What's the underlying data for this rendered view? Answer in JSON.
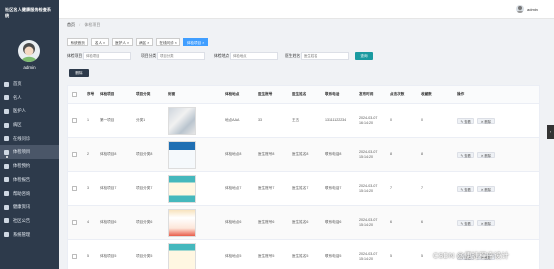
{
  "sidebar": {
    "title": "社区名人健康服务检查系统",
    "user": "admin",
    "items": [
      {
        "label": "首页",
        "icon": "home-icon"
      },
      {
        "label": "名人",
        "icon": "user-icon"
      },
      {
        "label": "医护人",
        "icon": "nurse-icon"
      },
      {
        "label": "病区",
        "icon": "ward-icon"
      },
      {
        "label": "在线问诊",
        "icon": "chat-icon"
      },
      {
        "label": "体检项目",
        "icon": "checkup-icon"
      },
      {
        "label": "体检预约",
        "icon": "calendar-icon"
      },
      {
        "label": "体检报告",
        "icon": "report-icon"
      },
      {
        "label": "帮助咨询",
        "icon": "help-icon"
      },
      {
        "label": "健康资讯",
        "icon": "news-icon"
      },
      {
        "label": "社区公告",
        "icon": "notice-icon"
      },
      {
        "label": "系统管理",
        "icon": "gear-icon"
      }
    ]
  },
  "header": {
    "user": "admin"
  },
  "breadcrumb": {
    "home": "首页",
    "sep": "/",
    "current": "体检项目"
  },
  "tabs": [
    {
      "label": "系统首页"
    },
    {
      "label": "名人 ×"
    },
    {
      "label": "医护人 ×"
    },
    {
      "label": "病区 ×"
    },
    {
      "label": "在线问诊 ×"
    },
    {
      "label": "体检项目 ×"
    }
  ],
  "search": {
    "fields": [
      {
        "label": "体检项目",
        "placeholder": "体检项目"
      },
      {
        "label": "项目分类",
        "placeholder": "项目分类"
      },
      {
        "label": "体检地点",
        "placeholder": "体检地点"
      },
      {
        "label": "医生姓名",
        "placeholder": "医生姓名"
      }
    ],
    "button": "查询"
  },
  "toolbar": {
    "delete_label": "删除"
  },
  "table": {
    "headers": [
      "序号",
      "体检项目",
      "项目分类",
      "封面",
      "体检地点",
      "医生账号",
      "医生姓名",
      "联系电话",
      "发布时间",
      "点击次数",
      "收藏数",
      "操作"
    ],
    "rows": [
      {
        "no": "1",
        "item": "第一项目",
        "cat": "分类1",
        "img": "i1",
        "place": "地点AAA",
        "acct": "33",
        "doctor": "王五",
        "phone": "13111122234",
        "time": "2024-03-07 16:14:20",
        "clicks": "0",
        "fav": "0"
      },
      {
        "no": "2",
        "item": "体检项目8",
        "cat": "项目分类8",
        "img": "i2",
        "place": "体检地点8",
        "acct": "医生账号8",
        "doctor": "医生姓名8",
        "phone": "联系电话8",
        "time": "2024-03-07 15:14:20",
        "clicks": "8",
        "fav": "8"
      },
      {
        "no": "3",
        "item": "体检项目7",
        "cat": "项目分类7",
        "img": "i3",
        "place": "体检地点7",
        "acct": "医生账号7",
        "doctor": "医生姓名7",
        "phone": "联系电话7",
        "time": "2024-03-07 15:14:20",
        "clicks": "7",
        "fav": "7"
      },
      {
        "no": "4",
        "item": "体检项目6",
        "cat": "项目分类6",
        "img": "i4",
        "place": "体检地点6",
        "acct": "医生账号6",
        "doctor": "医生姓名6",
        "phone": "联系电话6",
        "time": "2024-03-07 15:14:20",
        "clicks": "6",
        "fav": "6"
      },
      {
        "no": "5",
        "item": "体检项目5",
        "cat": "项目分类5",
        "img": "i5",
        "place": "体检地点5",
        "acct": "医生账号5",
        "doctor": "医生姓名5",
        "phone": "联系电话5",
        "time": "2024-03-07 15:14:20",
        "clicks": "5",
        "fav": "5"
      }
    ],
    "actions": {
      "view": "查看",
      "delete": "删除"
    }
  },
  "watermark": "CSDN @便捷程序设计",
  "colors": {
    "sidebar": "#2d3a4b",
    "accent": "#1a9aa0",
    "tab_active": "#409eff"
  }
}
